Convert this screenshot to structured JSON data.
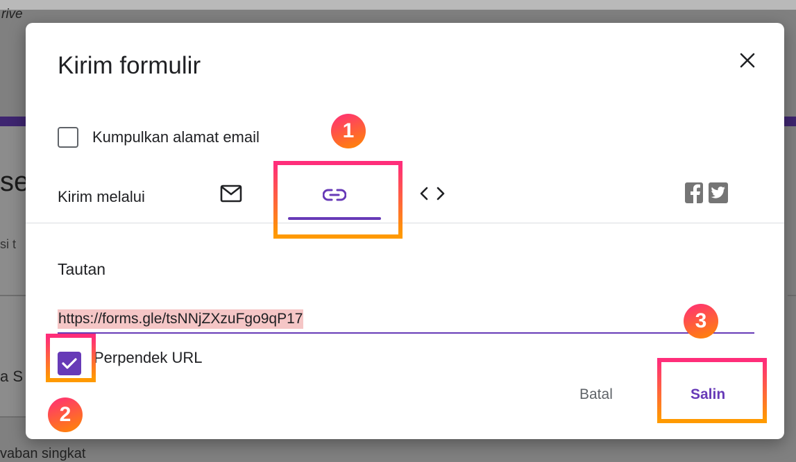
{
  "background": {
    "drive_fragment": "rive",
    "heading_fragment": "se",
    "subtitle_fragment": "si t",
    "question_fragment": "a S",
    "bottom_fragment": "vaban singkat"
  },
  "dialog": {
    "title": "Kirim formulir",
    "close_icon": "close-icon",
    "collect_email_label": "Kumpulkan alamat email",
    "send_via_label": "Kirim melalui",
    "tabs": [
      {
        "icon": "email-icon",
        "active": false
      },
      {
        "icon": "link-icon",
        "active": true
      },
      {
        "icon": "code-icon",
        "active": false
      }
    ],
    "social": [
      "facebook-icon",
      "twitter-icon"
    ],
    "section_title": "Tautan",
    "url_value": "https://forms.gle/tsNNjZXzuFgo9qP17",
    "shorten_url_label": "Perpendek URL",
    "shorten_url_checked": true,
    "cancel_label": "Batal",
    "copy_label": "Salin"
  },
  "annotations": {
    "badges": [
      "1",
      "2",
      "3"
    ]
  },
  "colors": {
    "accent": "#673ab7",
    "highlight_start": "#ff2d7a",
    "highlight_end": "#ff9a00",
    "selection": "#f5c6c6"
  }
}
